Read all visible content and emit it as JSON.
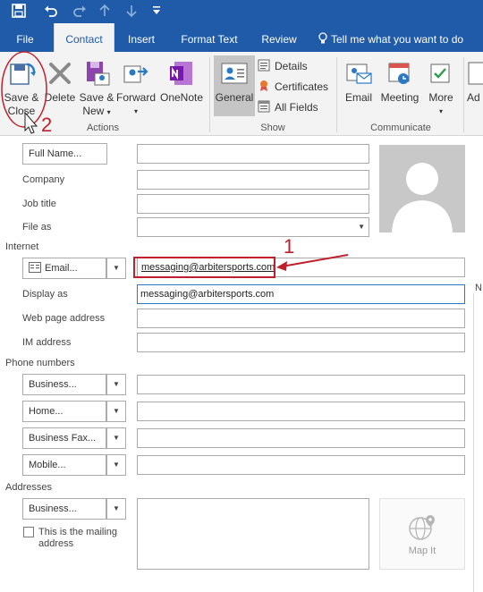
{
  "quick_access": {
    "icons": [
      "save-icon",
      "undo-icon",
      "redo-icon",
      "up-arrow-icon",
      "down-arrow-icon",
      "customize-icon"
    ]
  },
  "tabs": [
    {
      "label": "File"
    },
    {
      "label": "Contact"
    },
    {
      "label": "Insert"
    },
    {
      "label": "Format Text"
    },
    {
      "label": "Review"
    },
    {
      "label": "Tell me what you want to do"
    }
  ],
  "ribbon": {
    "actions": {
      "save_close_line1": "Save &",
      "save_close_line2": "Close",
      "delete": "Delete",
      "save_new_line1": "Save &",
      "save_new_line2": "New",
      "forward": "Forward",
      "onenote": "OneNote",
      "group_label": "Actions"
    },
    "show": {
      "general": "General",
      "details": "Details",
      "certificates": "Certificates",
      "all_fields": "All Fields",
      "group_label": "Show"
    },
    "communicate": {
      "email": "Email",
      "meeting": "Meeting",
      "more": "More",
      "group_label": "Communicate"
    },
    "cut_off": "Ad"
  },
  "annotations": {
    "step1": "1",
    "step2": "2",
    "accent": "#c0202b"
  },
  "form": {
    "full_name_button": "Full Name...",
    "company_label": "Company",
    "job_title_label": "Job title",
    "file_as_label": "File as",
    "internet_section": "Internet",
    "email_button": "Email...",
    "email_value": "messaging@arbitersports.com",
    "display_as_label": "Display as",
    "display_as_value": "messaging@arbitersports.com",
    "web_page_label": "Web page address",
    "im_label": "IM address",
    "phone_section": "Phone numbers",
    "phone_buttons": [
      "Business...",
      "Home...",
      "Business Fax...",
      "Mobile..."
    ],
    "addresses_section": "Addresses",
    "address_button": "Business...",
    "mailing_checkbox_line1": "This is the mailing",
    "mailing_checkbox_line2": "address",
    "map_it": "Map It",
    "notes_cut": "N"
  },
  "colors": {
    "title_bar": "#1f5ba8",
    "ribbon_bg": "#f3f3f3",
    "focus_border": "#2b78c5"
  }
}
